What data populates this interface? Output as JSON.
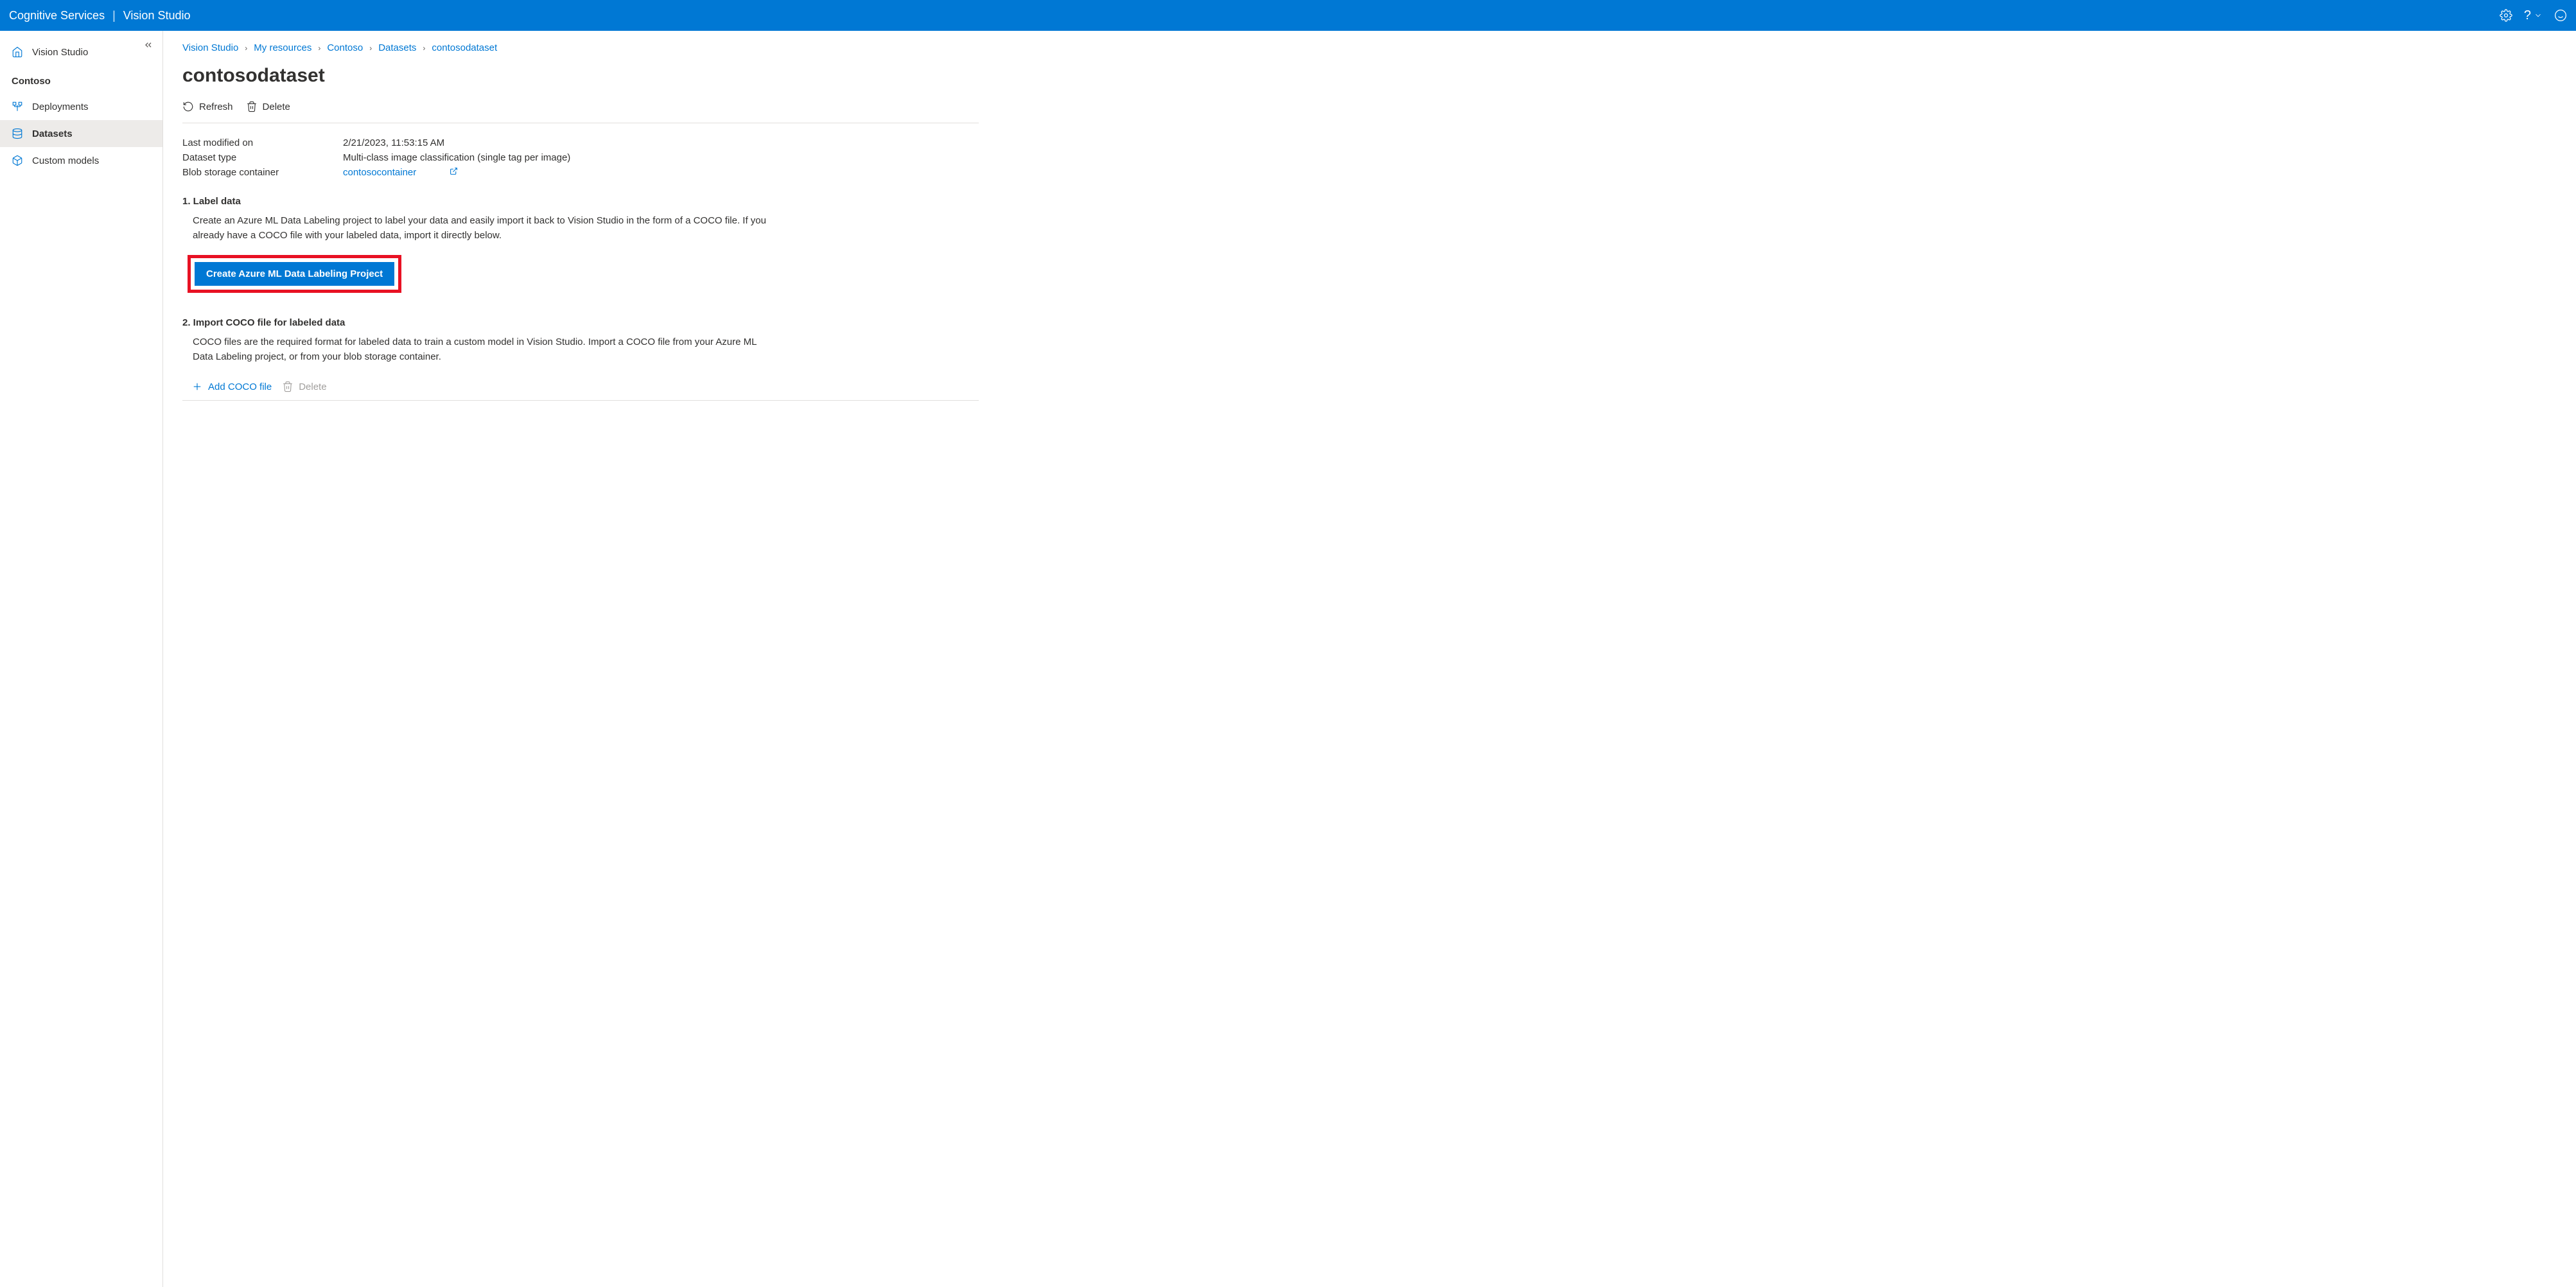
{
  "header": {
    "app_name": "Cognitive Services",
    "studio_name": "Vision Studio"
  },
  "sidebar": {
    "home_label": "Vision Studio",
    "resource_label": "Contoso",
    "items": [
      {
        "label": "Deployments"
      },
      {
        "label": "Datasets"
      },
      {
        "label": "Custom models"
      }
    ]
  },
  "breadcrumb": {
    "items": [
      "Vision Studio",
      "My resources",
      "Contoso",
      "Datasets",
      "contosodataset"
    ]
  },
  "page": {
    "title": "contosodataset",
    "refresh_label": "Refresh",
    "delete_label": "Delete"
  },
  "info": {
    "last_modified_label": "Last modified on",
    "last_modified_value": "2/21/2023, 11:53:15 AM",
    "dataset_type_label": "Dataset type",
    "dataset_type_value": "Multi-class image classification (single tag per image)",
    "blob_label": "Blob storage container",
    "blob_value": "contosocontainer"
  },
  "section1": {
    "heading": "1. Label data",
    "body": "Create an Azure ML Data Labeling project to label your data and easily import it back to Vision Studio in the form of a COCO file. If you already have a COCO file with your labeled data, import it directly below.",
    "button_label": "Create Azure ML Data Labeling Project"
  },
  "section2": {
    "heading": "2. Import COCO file for labeled data",
    "body": "COCO files are the required format for labeled data to train a custom model in Vision Studio. Import a COCO file from your Azure ML Data Labeling project, or from your blob storage container.",
    "add_label": "Add COCO file",
    "delete_label": "Delete"
  }
}
